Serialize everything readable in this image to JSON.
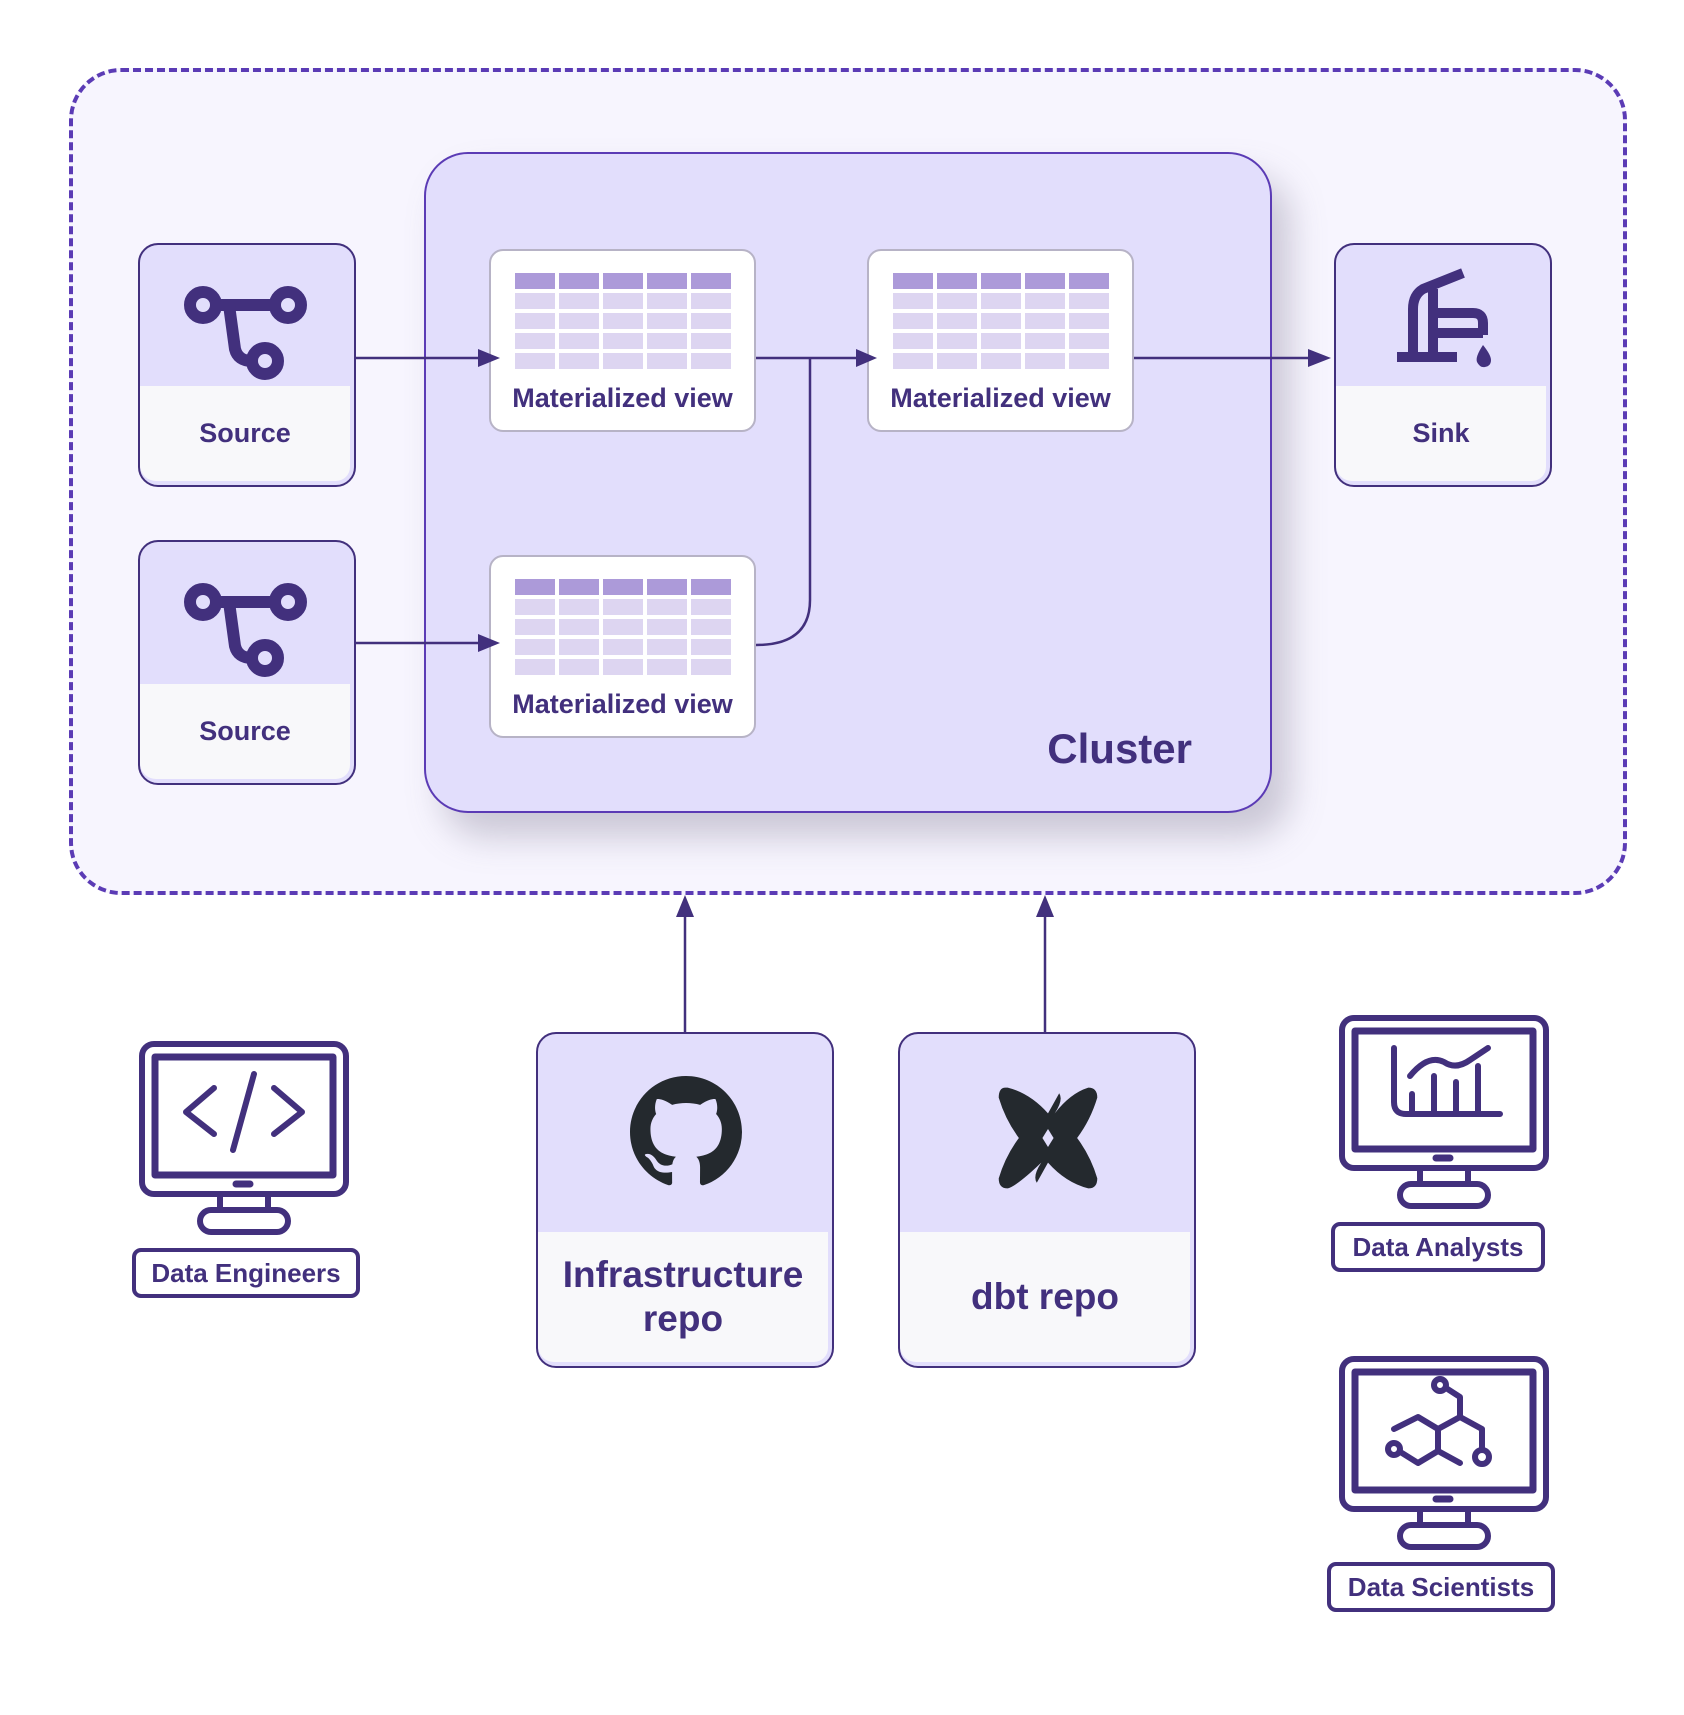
{
  "colors": {
    "primary": "#42307d",
    "dashed_border": "#5b3bb5",
    "outer_fill": "#f7f5fe",
    "cluster_fill": "#e2defc",
    "node_label_fill": "#f8f8fa",
    "table_header": "#ac9ad9",
    "table_cell": "#ddd5f1",
    "logo_dark": "#24292e"
  },
  "cluster": {
    "label": "Cluster"
  },
  "sources": [
    {
      "label": "Source",
      "icon": "git-branch-icon"
    },
    {
      "label": "Source",
      "icon": "git-branch-icon"
    }
  ],
  "materialized_views": [
    {
      "label": "Materialized view",
      "icon": "table-icon"
    },
    {
      "label": "Materialized view",
      "icon": "table-icon"
    },
    {
      "label": "Materialized view",
      "icon": "table-icon"
    }
  ],
  "sink": {
    "label": "Sink",
    "icon": "faucet-icon"
  },
  "repos": [
    {
      "label_line1": "Infrastructure",
      "label_line2": "repo",
      "icon": "github-icon"
    },
    {
      "label_line1": "dbt repo",
      "icon": "dbt-icon"
    }
  ],
  "personas": [
    {
      "label": "Data Engineers",
      "icon": "code-monitor-icon"
    },
    {
      "label": "Data Analysts",
      "icon": "chart-monitor-icon"
    },
    {
      "label": "Data Scientists",
      "icon": "molecule-monitor-icon"
    }
  ],
  "edges": [
    {
      "from": "Source 1",
      "to": "Materialized view 1"
    },
    {
      "from": "Source 2",
      "to": "Materialized view 3"
    },
    {
      "from": "Materialized view 1",
      "to": "Materialized view 2"
    },
    {
      "from": "Materialized view 3",
      "to": "Materialized view 2"
    },
    {
      "from": "Materialized view 2",
      "to": "Sink"
    },
    {
      "from": "Infrastructure repo",
      "to": "Outer environment"
    },
    {
      "from": "dbt repo",
      "to": "Outer environment"
    }
  ]
}
